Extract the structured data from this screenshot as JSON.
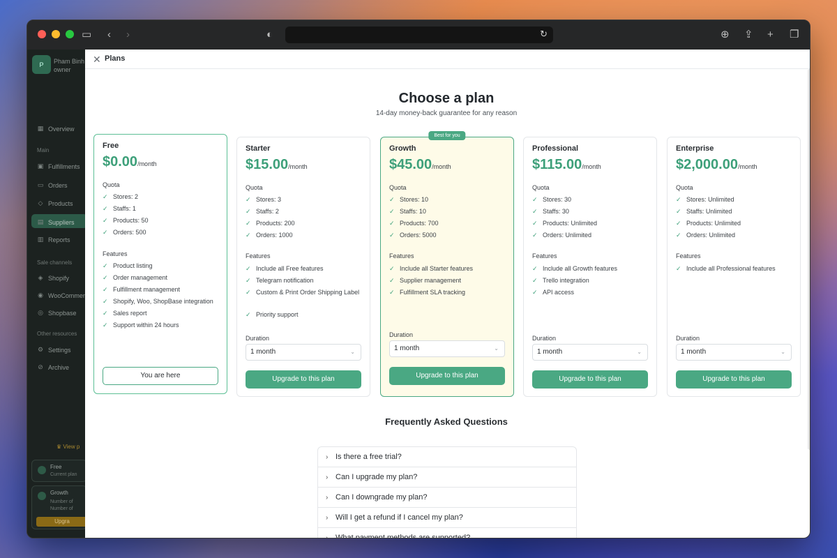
{
  "sidebar": {
    "avatar_initial": "P",
    "user_name": "Pham Binh",
    "user_role": "owner",
    "overview": "Overview",
    "section_main": "Main",
    "items_main": [
      "Fulfillments",
      "Orders",
      "Products",
      "Suppliers",
      "Reports"
    ],
    "section_channels": "Sale channels",
    "items_channels": [
      "Shopify",
      "WooCommerce",
      "Shopbase"
    ],
    "section_other": "Other resources",
    "items_other": [
      "Settings",
      "Archive"
    ],
    "promo": "View p",
    "card_free_title": "Free",
    "card_free_sub": "Current plan",
    "card_growth_title": "Growth",
    "card_growth_line1": "Number of",
    "card_growth_line2": "Number of",
    "upgrade": "Upgra"
  },
  "panel": {
    "title": "Plans",
    "heading": "Choose a plan",
    "subheading": "14-day money-back guarantee for any reason"
  },
  "plans": [
    {
      "name": "Free",
      "price": "$0.00",
      "per": "/month",
      "badge": "",
      "quota_label": "Quota",
      "quota": [
        "Stores: 2",
        "Staffs: 1",
        "Products: 50",
        "Orders: 500"
      ],
      "features_label": "Features",
      "features": [
        "Product listing",
        "Order management",
        "Fulfillment management",
        "Shopify, Woo, ShopBase integration",
        "Sales report",
        "Support within 24 hours"
      ],
      "duration_label": "",
      "duration": "",
      "button": "You are here"
    },
    {
      "name": "Starter",
      "price": "$15.00",
      "per": "/month",
      "badge": "",
      "quota_label": "Quota",
      "quota": [
        "Stores: 3",
        "Staffs: 2",
        "Products: 200",
        "Orders: 1000"
      ],
      "features_label": "Features",
      "features": [
        "Include all Free features",
        "Telegram notification",
        "Custom & Print Order Shipping Label",
        "Priority support"
      ],
      "duration_label": "Duration",
      "duration": "1 month",
      "button": "Upgrade to this plan"
    },
    {
      "name": "Growth",
      "price": "$45.00",
      "per": "/month",
      "badge": "Best for you",
      "quota_label": "Quota",
      "quota": [
        "Stores: 10",
        "Staffs: 10",
        "Products: 700",
        "Orders: 5000"
      ],
      "features_label": "Features",
      "features": [
        "Include all Starter features",
        "Supplier management",
        "Fulfillment SLA tracking"
      ],
      "duration_label": "Duration",
      "duration": "1 month",
      "button": "Upgrade to this plan"
    },
    {
      "name": "Professional",
      "price": "$115.00",
      "per": "/month",
      "badge": "",
      "quota_label": "Quota",
      "quota": [
        "Stores: 30",
        "Staffs: 30",
        "Products: Unlimited",
        "Orders: Unlimited"
      ],
      "features_label": "Features",
      "features": [
        "Include all Growth features",
        "Trello integration",
        "API access"
      ],
      "duration_label": "Duration",
      "duration": "1 month",
      "button": "Upgrade to this plan"
    },
    {
      "name": "Enterprise",
      "price": "$2,000.00",
      "per": "/month",
      "badge": "",
      "quota_label": "Quota",
      "quota": [
        "Stores: Unlimited",
        "Staffs: Unlimited",
        "Products: Unlimited",
        "Orders: Unlimited"
      ],
      "features_label": "Features",
      "features": [
        "Include all Professional features"
      ],
      "duration_label": "Duration",
      "duration": "1 month",
      "button": "Upgrade to this plan"
    }
  ],
  "faq": {
    "title": "Frequently Asked Questions",
    "items": [
      "Is there a free trial?",
      "Can I upgrade my plan?",
      "Can I downgrade my plan?",
      "Will I get a refund if I cancel my plan?",
      "What payment methods are supported?"
    ]
  },
  "colors": {
    "accent": "#4aa883",
    "price": "#3ea07a",
    "featured_bg": "#fefbe8"
  }
}
